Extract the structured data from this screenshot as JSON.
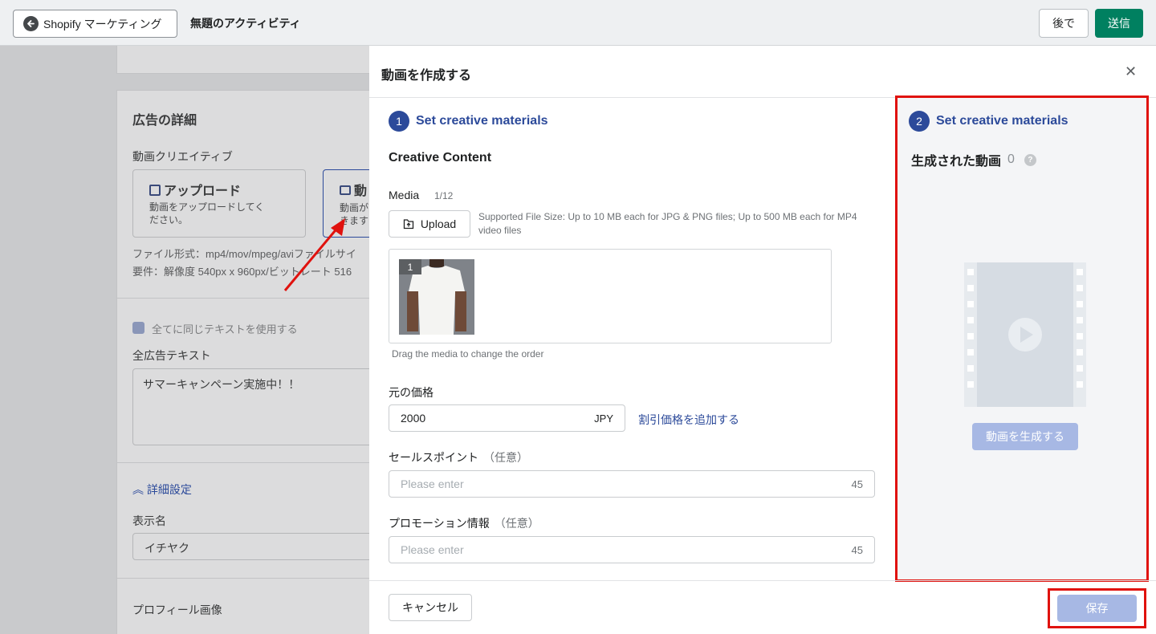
{
  "topbar": {
    "back_label": "Shopify マーケティング",
    "title": "無題のアクティビティ",
    "later_label": "後で",
    "send_label": "送信"
  },
  "background": {
    "ad_details_title": "広告の詳細",
    "video_creative_label": "動画クリエイティブ",
    "upload_option_title": "アップロード",
    "upload_option_desc": "動画をアップロードしてください。",
    "generate_option_title": "動",
    "generate_option_desc": "動画が",
    "generate_option_desc2": "きます",
    "file_format": "ファイル形式：mp4/mov/mpeg/aviファイルサイ",
    "requirements": "要件：解像度 540px x 960px/ビットレート 516",
    "same_text_checkbox": "全てに同じテキストを使用する",
    "all_ad_text_label": "全広告テキスト",
    "all_ad_text_value": "サマーキャンペーン実施中！！",
    "advanced_settings": "詳細設定",
    "display_name_label": "表示名",
    "display_name_value": "イチヤク",
    "profile_image_label": "プロフィール画像"
  },
  "modal": {
    "title": "動画を作成する",
    "step1": {
      "num": "1",
      "label": "Set creative materials"
    },
    "creative_content_title": "Creative Content",
    "media_label": "Media",
    "media_count": "1/12",
    "upload_label": "Upload",
    "upload_hint": "Supported File Size: Up to 10 MB each for JPG & PNG files; Up to 500 MB each for MP4 video files",
    "thumb_badge": "1",
    "drag_hint": "Drag the media to change the order",
    "price_label": "元の価格",
    "price_value": "2000",
    "price_currency": "JPY",
    "discount_link": "割引価格を追加する",
    "sales_point_label": "セールスポイント",
    "sales_point_optional": "（任意）",
    "sales_point_placeholder": "Please enter",
    "sales_point_limit": "45",
    "promo_label": "プロモーション情報",
    "promo_optional": "（任意）",
    "promo_placeholder": "Please enter",
    "promo_limit": "45",
    "step2": {
      "num": "2",
      "label": "Set creative materials"
    },
    "generated_title": "生成された動画",
    "generated_count": "0",
    "help_icon": "?",
    "generate_button": "動画を生成する",
    "cancel_label": "キャンセル",
    "save_label": "保存"
  },
  "colors": {
    "accent": "#2c4a9a",
    "primary_green": "#008060",
    "highlight_red": "#e0120e",
    "disabled_blue": "#a7b8e4"
  }
}
